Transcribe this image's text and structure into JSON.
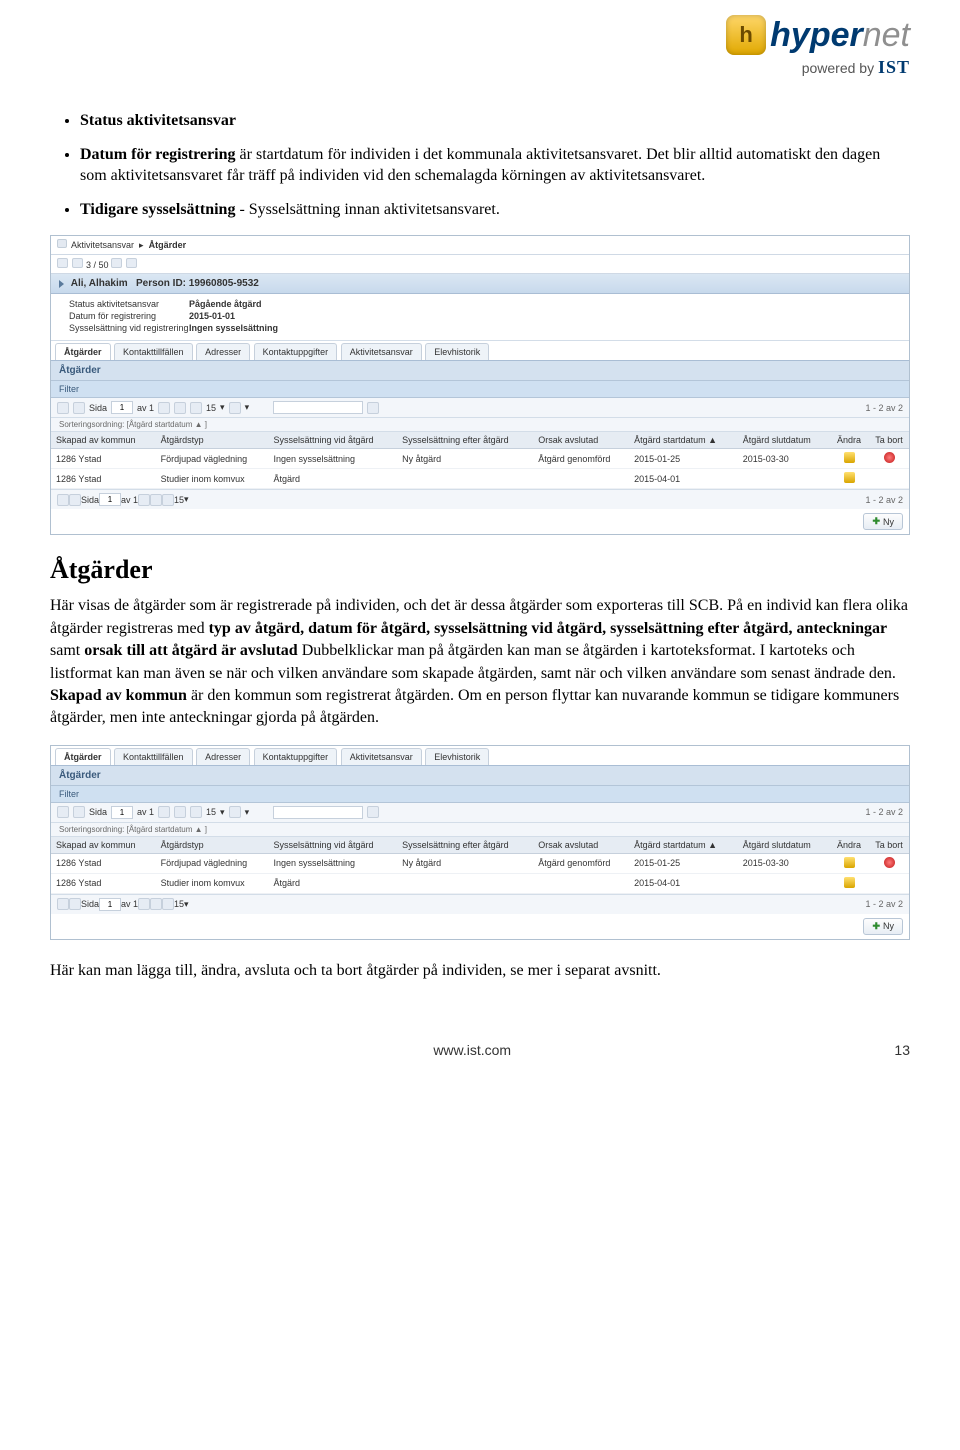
{
  "logo": {
    "badge_letter": "h",
    "brand_a": "hyper",
    "brand_b": "net",
    "powered": "powered by ",
    "ist": "IST"
  },
  "bullets": {
    "b1": "Status aktivitetsansvar",
    "b2_lead": "Datum för registrering ",
    "b2_rest": "är startdatum för individen i det kommunala aktivitetsansvaret. Det blir alltid automatiskt den dagen som aktivitetsansvaret får träff på individen vid den schemalagda körningen av aktivitetsansvaret.",
    "b3_lead": "Tidigare sysselsättning ",
    "b3_rest": "- Sysselsättning innan aktivitetsansvaret."
  },
  "ui1": {
    "breadcrumb_a": "Aktivitetsansvar",
    "breadcrumb_b": "Åtgärder",
    "top_pager": "3 / 50",
    "person_name": "Ali, Alhakim",
    "person_id_label": "Person ID:",
    "person_id": "19960805-9532",
    "info": {
      "status_lbl": "Status aktivitetsansvar",
      "status_val": "Pågående åtgärd",
      "reg_lbl": "Datum för registrering",
      "reg_val": "2015-01-01",
      "syss_lbl": "Sysselsättning vid registrering",
      "syss_val": "Ingen sysselsättning"
    },
    "tabs": [
      "Åtgärder",
      "Kontakttillfällen",
      "Adresser",
      "Kontaktuppgifter",
      "Aktivitetsansvar",
      "Elevhistorik"
    ],
    "section": "Åtgärder",
    "filter": "Filter",
    "page_label": "Sida",
    "page_val": "1",
    "page_of": "av 1",
    "per_page": "15",
    "count": "1 - 2 av 2",
    "sort": "Sorteringsordning: [Åtgärd startdatum ▲ ]",
    "cols": {
      "skapad": "Skapad av kommun",
      "typ": "Åtgärdstyp",
      "syss_vid": "Sysselsättning vid åtgärd",
      "syss_efter": "Sysselsättning efter åtgärd",
      "orsak": "Orsak avslutad",
      "start": "Åtgärd startdatum ▲",
      "slut": "Åtgärd slutdatum",
      "andra": "Ändra",
      "tabort": "Ta bort"
    },
    "rows": [
      {
        "kommun": "1286 Ystad",
        "typ": "Fördjupad vägledning",
        "vid": "Ingen sysselsättning",
        "efter": "Ny åtgärd",
        "orsak": "Åtgärd genomförd",
        "start": "2015-01-25",
        "slut": "2015-03-30",
        "del": true
      },
      {
        "kommun": "1286 Ystad",
        "typ": "Studier inom komvux",
        "vid": "Åtgärd",
        "efter": "",
        "orsak": "",
        "start": "2015-04-01",
        "slut": "",
        "del": false
      }
    ],
    "ny_btn": "Ny"
  },
  "heading": "Åtgärder",
  "para1_a": "Här visas de åtgärder som är registrerade på individen, och det är dessa åtgärder som exporteras till SCB. På en individ kan flera olika åtgärder registreras med ",
  "para1_b1": "typ av åtgärd, datum för åtgärd, sysselsättning vid åtgärd, sysselsättning efter åtgärd, anteckningar",
  "para1_c": " samt ",
  "para1_b2": "orsak till att åtgärd är avslutad ",
  "para1_d": "Dubbelklickar man på åtgärden kan man se åtgärden i kartoteksformat. I kartoteks och listformat kan man även se när och vilken användare som skapade åtgärden, samt när och vilken användare som senast ändrade den. ",
  "para1_b3": "Skapad av kommun",
  "para1_e": " är den kommun som registrerat åtgärden. Om en person flyttar kan nuvarande kommun se tidigare kommuners åtgärder, men inte anteckningar gjorda på åtgärden.",
  "ui2": {
    "count": "1 - 2 av 2"
  },
  "para2": "Här kan man lägga till, ändra, avsluta och ta bort åtgärder på individen, se mer i separat avsnitt.",
  "footer": {
    "url": "www.ist.com",
    "page": "13"
  }
}
